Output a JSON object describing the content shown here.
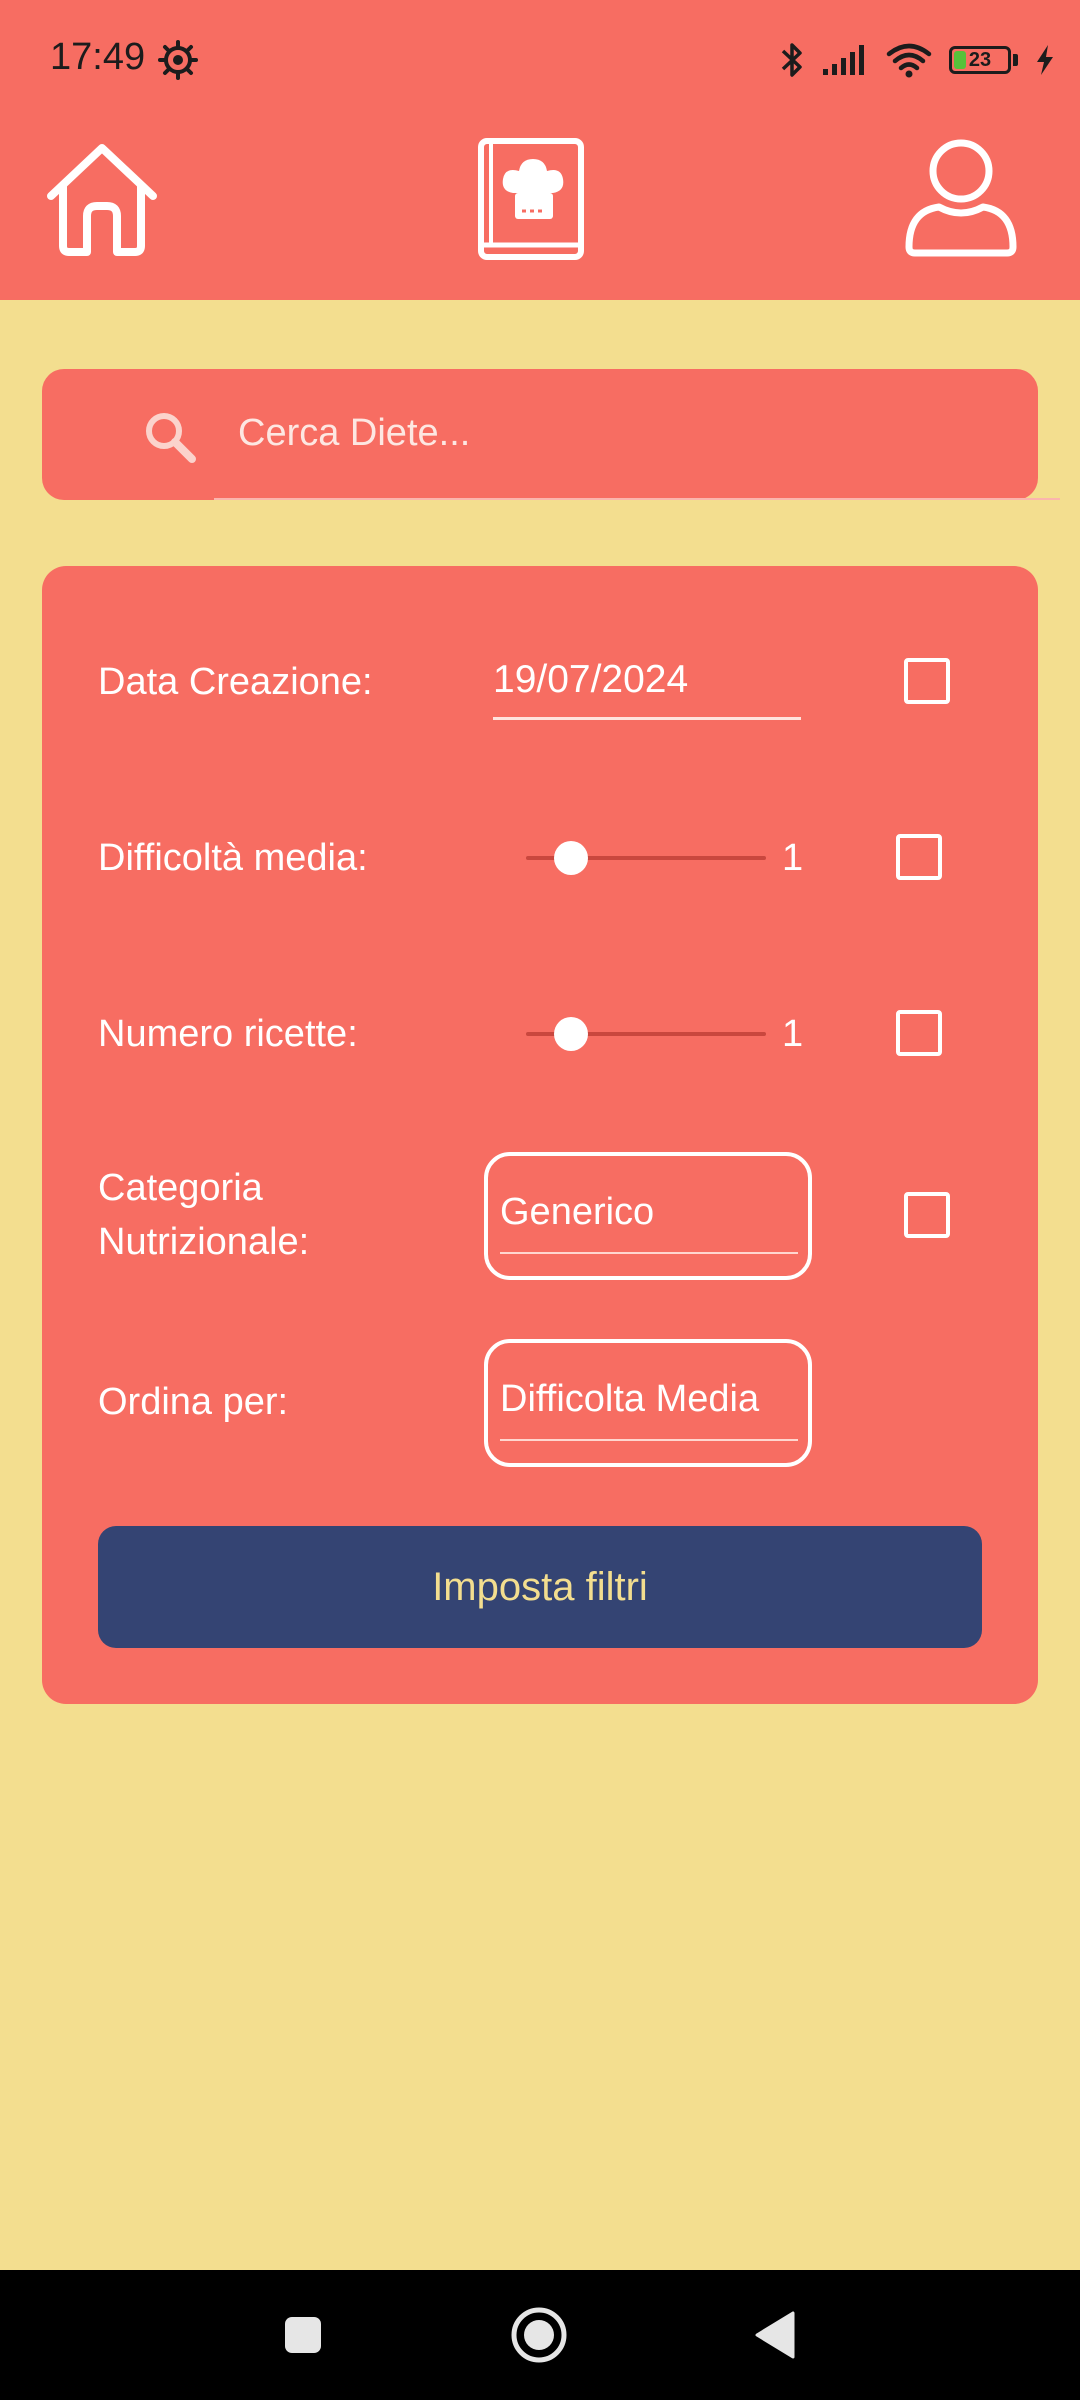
{
  "status_bar": {
    "time": "17:49",
    "battery_level": "23",
    "icons": [
      "settings-icon",
      "bluetooth-icon",
      "signal-icon",
      "wifi-icon",
      "battery-icon",
      "charging-icon"
    ]
  },
  "nav": {
    "items": [
      {
        "name": "home",
        "icon": "home-icon"
      },
      {
        "name": "recipe-book",
        "icon": "recipe-book-icon"
      },
      {
        "name": "profile",
        "icon": "user-icon"
      }
    ]
  },
  "search": {
    "placeholder": "Cerca Diete...",
    "value": ""
  },
  "filters": {
    "data_creazione": {
      "label": "Data Creazione:",
      "value": "19/07/2024",
      "checked": false
    },
    "difficolta_media": {
      "label": "Difficoltà media:",
      "value": "1",
      "checked": false
    },
    "numero_ricette": {
      "label": "Numero ricette:",
      "value": "1",
      "checked": false
    },
    "categoria_nutrizionale": {
      "label_line1": "Categoria",
      "label_line2": "Nutrizionale:",
      "value": "Generico",
      "checked": false
    },
    "ordina_per": {
      "label": "Ordina per:",
      "value": "Difficolta Media"
    }
  },
  "apply_button_label": "Imposta filtri",
  "colors": {
    "background": "#f3de8f",
    "primary": "#f76d62",
    "button": "#344473",
    "button_text": "#f3de8f",
    "text": "#ffffff"
  }
}
